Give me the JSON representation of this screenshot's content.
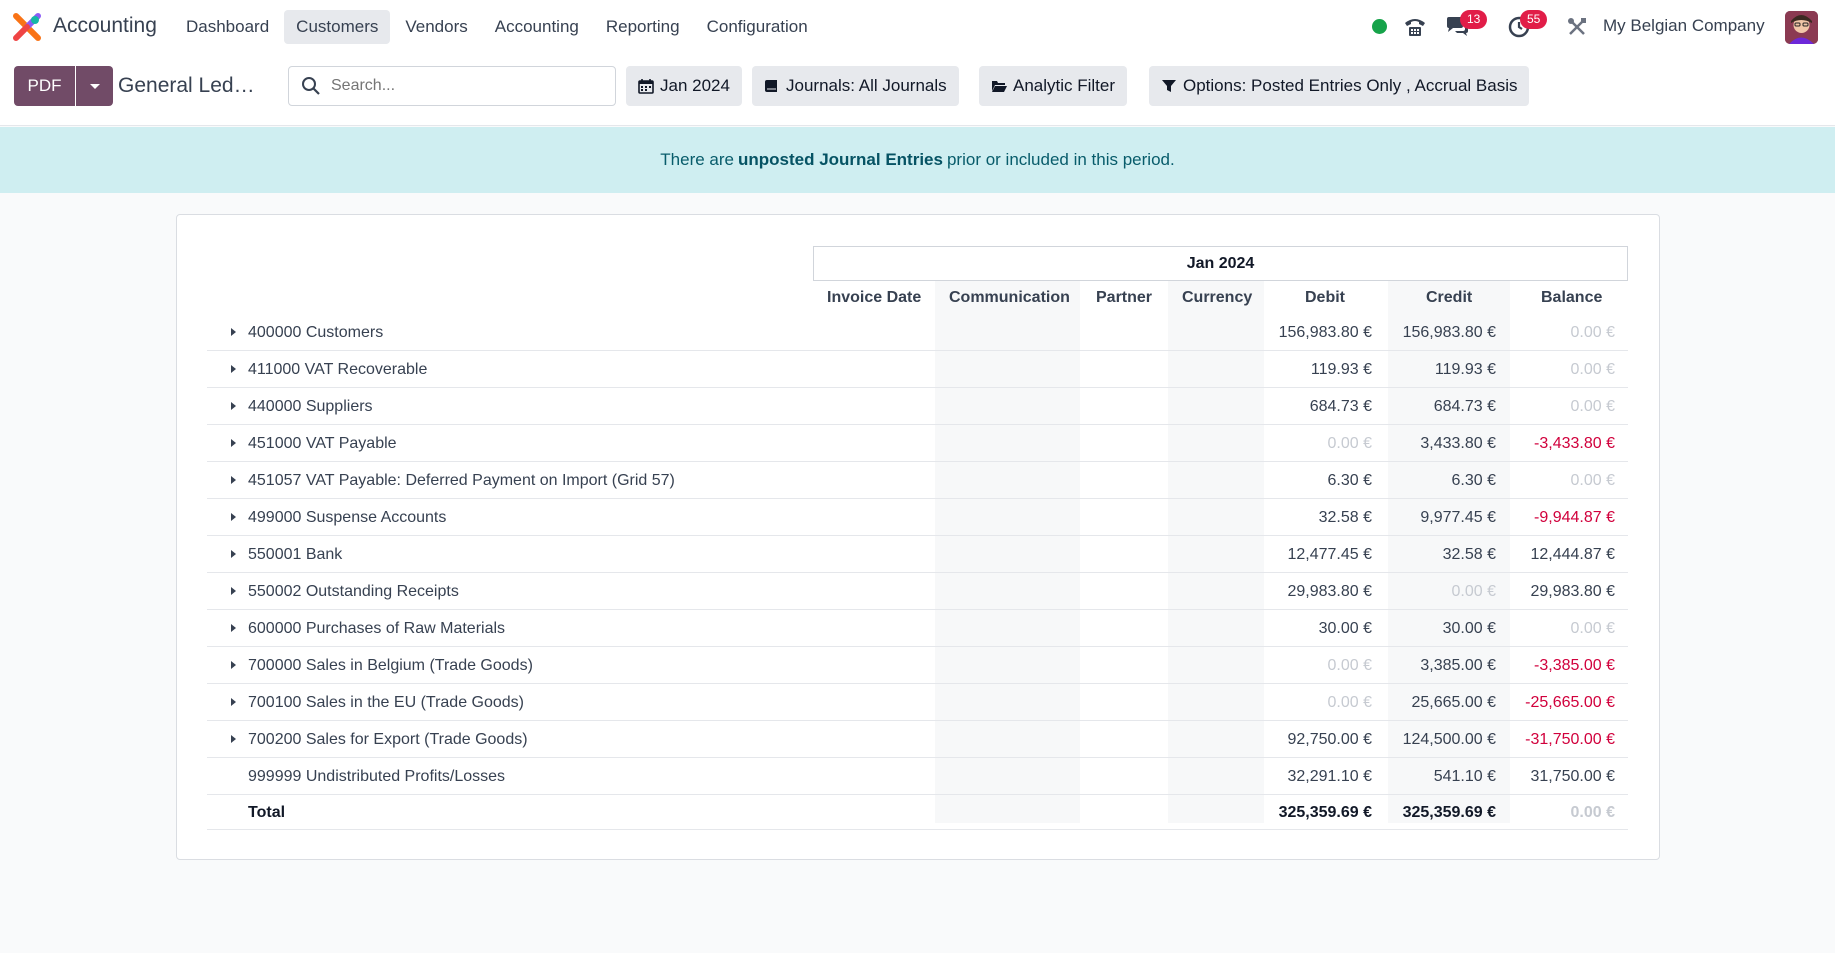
{
  "app": {
    "name": "Accounting"
  },
  "menu": [
    {
      "label": "Dashboard",
      "active": false
    },
    {
      "label": "Customers",
      "active": true
    },
    {
      "label": "Vendors",
      "active": false
    },
    {
      "label": "Accounting",
      "active": false
    },
    {
      "label": "Reporting",
      "active": false
    },
    {
      "label": "Configuration",
      "active": false
    }
  ],
  "systray": {
    "messages_count": "13",
    "activities_count": "55",
    "company": "My Belgian Company"
  },
  "control": {
    "pdf_label": "PDF",
    "breadcrumb": "General Led…",
    "search_placeholder": "Search...",
    "filters": [
      {
        "label": "Jan 2024",
        "icon": "calendar-icon"
      },
      {
        "label": "Journals: All Journals",
        "icon": "book-icon"
      },
      {
        "label": "Analytic Filter",
        "icon": "folder-open-icon"
      },
      {
        "label": "Options: Posted Entries Only , Accrual Basis",
        "icon": "filter-icon"
      }
    ]
  },
  "alert": {
    "before": "There are",
    "link": "unposted Journal Entries",
    "after": "prior or included in this period."
  },
  "report": {
    "period": "Jan 2024",
    "headers": {
      "invoice_date": "Invoice Date",
      "communication": "Communication",
      "partner": "Partner",
      "currency": "Currency",
      "debit": "Debit",
      "credit": "Credit",
      "balance": "Balance"
    },
    "rows": [
      {
        "name": "400000 Customers",
        "debit": "156,983.80 €",
        "credit": "156,983.80 €",
        "balance": "0.00 €",
        "expandable": true
      },
      {
        "name": "411000 VAT Recoverable",
        "debit": "119.93 €",
        "credit": "119.93 €",
        "balance": "0.00 €",
        "expandable": true
      },
      {
        "name": "440000 Suppliers",
        "debit": "684.73 €",
        "credit": "684.73 €",
        "balance": "0.00 €",
        "expandable": true
      },
      {
        "name": "451000 VAT Payable",
        "debit": "0.00 €",
        "credit": "3,433.80 €",
        "balance": "-3,433.80 €",
        "expandable": true
      },
      {
        "name": "451057 VAT Payable: Deferred Payment on Import (Grid 57)",
        "debit": "6.30 €",
        "credit": "6.30 €",
        "balance": "0.00 €",
        "expandable": true
      },
      {
        "name": "499000 Suspense Accounts",
        "debit": "32.58 €",
        "credit": "9,977.45 €",
        "balance": "-9,944.87 €",
        "expandable": true
      },
      {
        "name": "550001 Bank",
        "debit": "12,477.45 €",
        "credit": "32.58 €",
        "balance": "12,444.87 €",
        "expandable": true
      },
      {
        "name": "550002 Outstanding Receipts",
        "debit": "29,983.80 €",
        "credit": "0.00 €",
        "balance": "29,983.80 €",
        "expandable": true
      },
      {
        "name": "600000 Purchases of Raw Materials",
        "debit": "30.00 €",
        "credit": "30.00 €",
        "balance": "0.00 €",
        "expandable": true
      },
      {
        "name": "700000 Sales in Belgium (Trade Goods)",
        "debit": "0.00 €",
        "credit": "3,385.00 €",
        "balance": "-3,385.00 €",
        "expandable": true
      },
      {
        "name": "700100 Sales in the EU (Trade Goods)",
        "debit": "0.00 €",
        "credit": "25,665.00 €",
        "balance": "-25,665.00 €",
        "expandable": true
      },
      {
        "name": "700200 Sales for Export (Trade Goods)",
        "debit": "92,750.00 €",
        "credit": "124,500.00 €",
        "balance": "-31,750.00 €",
        "expandable": true
      },
      {
        "name": "999999 Undistributed Profits/Losses",
        "debit": "32,291.10 €",
        "credit": "541.10 €",
        "balance": "31,750.00 €",
        "expandable": false
      }
    ],
    "total": {
      "name": "Total",
      "debit": "325,359.69 €",
      "credit": "325,359.69 €",
      "balance": "0.00 €"
    }
  },
  "colors": {
    "brand": "#714b67",
    "negative": "#d1003c",
    "muted": "#c6cad1",
    "alert_bg": "#cfeef1"
  }
}
